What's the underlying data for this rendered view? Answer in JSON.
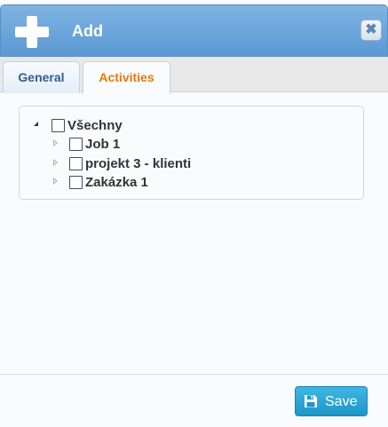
{
  "dialog": {
    "title": "Add",
    "title_icon": "plus-icon",
    "close_icon": "close-icon"
  },
  "tabs": [
    {
      "label": "General",
      "active": false
    },
    {
      "label": "Activities",
      "active": true
    }
  ],
  "tree": {
    "root": {
      "label": "Všechny",
      "expanded": true,
      "checked": false
    },
    "children": [
      {
        "label": "Job 1",
        "expanded": false,
        "checked": false
      },
      {
        "label": "projekt 3 - klienti",
        "expanded": false,
        "checked": false
      },
      {
        "label": "Zakázka 1",
        "expanded": false,
        "checked": false
      }
    ]
  },
  "footer": {
    "save_label": "Save",
    "save_icon": "floppy-disk-icon"
  },
  "colors": {
    "titlebar": "#6aa5dc",
    "active_tab_text": "#e07a10",
    "inactive_tab_text": "#2c5f93",
    "save_button": "#2aa6d8"
  }
}
